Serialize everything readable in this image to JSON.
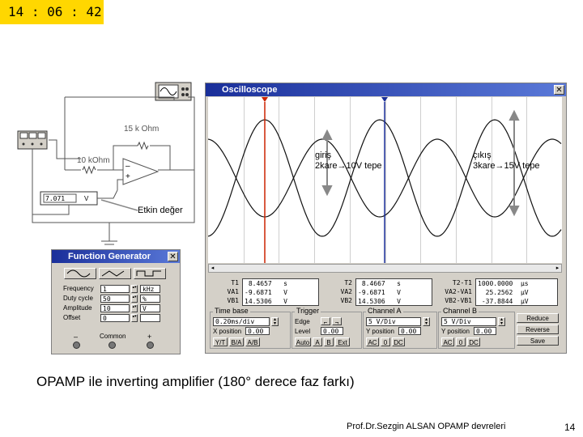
{
  "timer": "14 : 06 : 42",
  "circuit": {
    "feedback_resistor": "15 k Ohm",
    "input_resistor": "10 kOhm",
    "minus_sign": "–",
    "plus_sign": "+",
    "voltmeter_value": "7.071",
    "voltmeter_unit": "V",
    "rms_label": "Etkin değer"
  },
  "oscilloscope": {
    "title": "Oscilloscope",
    "annotation_input": "giriş\n2kare→10V tepe",
    "annotation_output": "çıkış\n3kare→15V tepe",
    "readouts": [
      {
        "labels": "T1\nVA1\nVB1",
        "values": " 8.4657   s\n-9.6871   V\n14.5306   V"
      },
      {
        "labels": "T2\nVA2\nVB2",
        "values": " 8.4667   s\n-9.6871   V\n14.5306   V"
      },
      {
        "labels": "T2-T1\nVA2-VA1\nVB2-VB1",
        "values": "1000.0000  µs\n  25.2562  µV\n -37.8844  µV"
      }
    ],
    "timebase": {
      "header": "Time base",
      "value": "0.20ms/div",
      "xpos_label": "X position",
      "xpos_value": "0.00",
      "modes": [
        "Y/T",
        "B/A",
        "A/B"
      ]
    },
    "trigger": {
      "header": "Trigger",
      "edge_label": "Edge",
      "level_label": "Level",
      "level_value": "0.00",
      "modes": [
        "Auto",
        "A",
        "B",
        "Ext"
      ]
    },
    "channel_a": {
      "header": "Channel A",
      "value": "5 V/Div",
      "ypos_label": "Y position",
      "ypos_value": "0.00",
      "modes": [
        "AC",
        "0",
        "DC"
      ]
    },
    "channel_b": {
      "header": "Channel B",
      "value": "5 V/Div",
      "ypos_label": "Y position",
      "ypos_value": "0.00",
      "modes": [
        "AC",
        "0",
        "DC"
      ]
    },
    "buttons": [
      "Reduce",
      "Reverse",
      "Save"
    ]
  },
  "function_generator": {
    "title": "Function Generator",
    "rows": [
      {
        "label": "Frequency",
        "value": "1",
        "unit": "kHz"
      },
      {
        "label": "Duty cycle",
        "value": "50",
        "unit": "%"
      },
      {
        "label": "Amplitude",
        "value": "10",
        "unit": "V"
      },
      {
        "label": "Offset",
        "value": "0",
        "unit": ""
      }
    ],
    "terminals": [
      "–",
      "Common",
      "+"
    ]
  },
  "caption": "OPAMP ile inverting amplifier (180° derece faz farkı)",
  "footer": {
    "author": "Prof.Dr.Sezgin ALSAN  OPAMP devreleri",
    "page": "14"
  }
}
